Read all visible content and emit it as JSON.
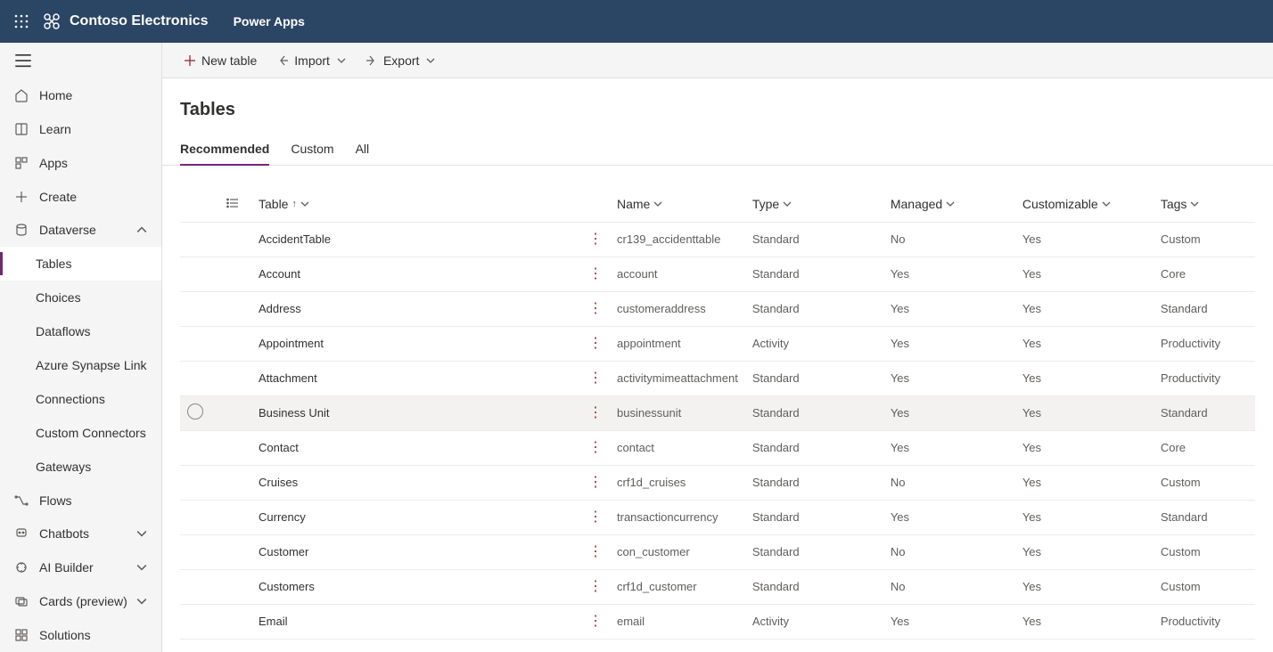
{
  "header": {
    "brand": "Contoso Electronics",
    "app": "Power Apps"
  },
  "sidebar": {
    "items": [
      {
        "label": "Home"
      },
      {
        "label": "Learn"
      },
      {
        "label": "Apps"
      },
      {
        "label": "Create"
      },
      {
        "label": "Dataverse",
        "expandable": true,
        "expanded": true
      },
      {
        "label": "Flows"
      },
      {
        "label": "Chatbots",
        "expandable": true
      },
      {
        "label": "AI Builder",
        "expandable": true
      },
      {
        "label": "Cards (preview)",
        "expandable": true
      },
      {
        "label": "Solutions"
      }
    ],
    "dataverse_children": [
      {
        "label": "Tables",
        "active": true
      },
      {
        "label": "Choices"
      },
      {
        "label": "Dataflows"
      },
      {
        "label": "Azure Synapse Link"
      },
      {
        "label": "Connections"
      },
      {
        "label": "Custom Connectors"
      },
      {
        "label": "Gateways"
      }
    ]
  },
  "commandbar": {
    "new_table": "New table",
    "import": "Import",
    "export": "Export"
  },
  "page": {
    "title": "Tables",
    "tabs": [
      {
        "label": "Recommended",
        "active": true
      },
      {
        "label": "Custom"
      },
      {
        "label": "All"
      }
    ]
  },
  "table": {
    "columns": {
      "table": "Table",
      "name": "Name",
      "type": "Type",
      "managed": "Managed",
      "customizable": "Customizable",
      "tags": "Tags"
    },
    "rows": [
      {
        "table": "AccidentTable",
        "name": "cr139_accidenttable",
        "type": "Standard",
        "managed": "No",
        "customizable": "Yes",
        "tags": "Custom"
      },
      {
        "table": "Account",
        "name": "account",
        "type": "Standard",
        "managed": "Yes",
        "customizable": "Yes",
        "tags": "Core"
      },
      {
        "table": "Address",
        "name": "customeraddress",
        "type": "Standard",
        "managed": "Yes",
        "customizable": "Yes",
        "tags": "Standard"
      },
      {
        "table": "Appointment",
        "name": "appointment",
        "type": "Activity",
        "managed": "Yes",
        "customizable": "Yes",
        "tags": "Productivity"
      },
      {
        "table": "Attachment",
        "name": "activitymimeattachment",
        "type": "Standard",
        "managed": "Yes",
        "customizable": "Yes",
        "tags": "Productivity"
      },
      {
        "table": "Business Unit",
        "name": "businessunit",
        "type": "Standard",
        "managed": "Yes",
        "customizable": "Yes",
        "tags": "Standard",
        "hovered": true
      },
      {
        "table": "Contact",
        "name": "contact",
        "type": "Standard",
        "managed": "Yes",
        "customizable": "Yes",
        "tags": "Core"
      },
      {
        "table": "Cruises",
        "name": "crf1d_cruises",
        "type": "Standard",
        "managed": "No",
        "customizable": "Yes",
        "tags": "Custom"
      },
      {
        "table": "Currency",
        "name": "transactioncurrency",
        "type": "Standard",
        "managed": "Yes",
        "customizable": "Yes",
        "tags": "Standard"
      },
      {
        "table": "Customer",
        "name": "con_customer",
        "type": "Standard",
        "managed": "No",
        "customizable": "Yes",
        "tags": "Custom"
      },
      {
        "table": "Customers",
        "name": "crf1d_customer",
        "type": "Standard",
        "managed": "No",
        "customizable": "Yes",
        "tags": "Custom"
      },
      {
        "table": "Email",
        "name": "email",
        "type": "Activity",
        "managed": "Yes",
        "customizable": "Yes",
        "tags": "Productivity"
      }
    ]
  }
}
